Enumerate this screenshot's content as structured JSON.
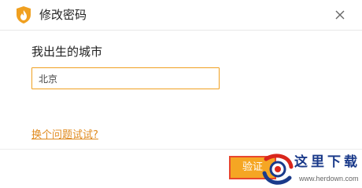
{
  "window": {
    "title": "修改密码"
  },
  "form": {
    "question_label": "我出生的城市",
    "answer_value": "北京",
    "switch_question_link": "换个问题试试?",
    "verify_button": "验证"
  },
  "watermark": {
    "brand_text": "这里下载",
    "url_text": "www.herdown.com"
  },
  "colors": {
    "accent": "#f5a623",
    "link": "#e08a1e",
    "input_border": "#f0a020",
    "highlight_border": "#e8472e",
    "watermark_blue": "#1a3a8a",
    "watermark_red": "#d9261c"
  },
  "icons": {
    "app": "flame-shield-icon",
    "close": "close-icon",
    "watermark": "swirl-logo-icon"
  }
}
